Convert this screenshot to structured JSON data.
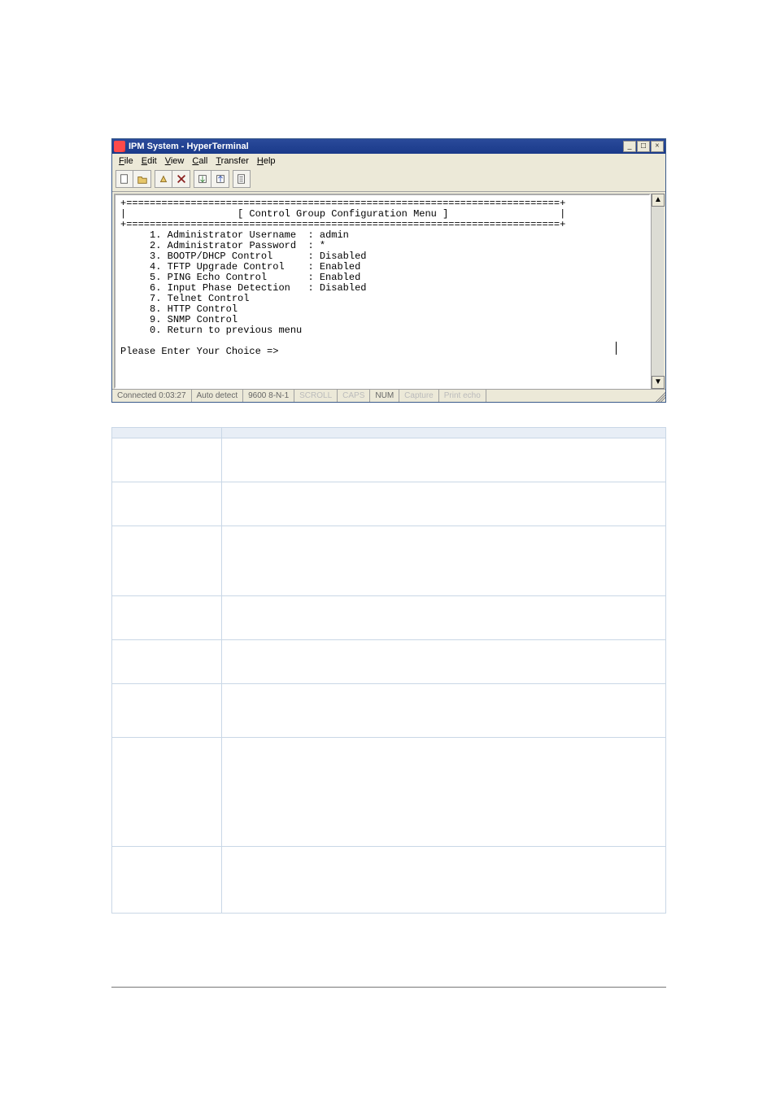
{
  "window": {
    "title": "IPM System - HyperTerminal",
    "controls": {
      "minimize": "_",
      "restore": "□",
      "close": "×"
    }
  },
  "menubar": {
    "items": [
      "File",
      "Edit",
      "View",
      "Call",
      "Transfer",
      "Help"
    ]
  },
  "toolbar": {
    "icons": [
      "new-icon",
      "open-icon",
      "connect-icon",
      "disconnect-icon",
      "send-icon",
      "receive-icon",
      "properties-icon"
    ]
  },
  "terminal": {
    "header": "[ Control Group Configuration Menu ]",
    "lines": [
      {
        "num": "1",
        "label": "Administrator Username",
        "value": "admin"
      },
      {
        "num": "2",
        "label": "Administrator Password",
        "value": "*"
      },
      {
        "num": "3",
        "label": "BOOTP/DHCP Control",
        "value": "Disabled"
      },
      {
        "num": "4",
        "label": "TFTP Upgrade Control",
        "value": "Enabled"
      },
      {
        "num": "5",
        "label": "PING Echo Control",
        "value": "Enabled"
      },
      {
        "num": "6",
        "label": "Input Phase Detection",
        "value": "Disabled"
      },
      {
        "num": "7",
        "label": "Telnet Control",
        "value": ""
      },
      {
        "num": "8",
        "label": "HTTP Control",
        "value": ""
      },
      {
        "num": "9",
        "label": "SNMP Control",
        "value": ""
      },
      {
        "num": "0",
        "label": "Return to previous menu",
        "value": ""
      }
    ],
    "prompt": "Please Enter Your Choice =>"
  },
  "statusbar": {
    "connected": "Connected 0:03:27",
    "detect": "Auto detect",
    "settings": "9600 8-N-1",
    "scroll": "SCROLL",
    "caps": "CAPS",
    "num": "NUM",
    "capture": "Capture",
    "echo": "Print echo"
  },
  "table": {
    "headers": [
      "",
      ""
    ],
    "rows": [
      [
        "",
        ""
      ],
      [
        "",
        ""
      ],
      [
        "",
        ""
      ],
      [
        "",
        ""
      ],
      [
        "",
        ""
      ],
      [
        "",
        ""
      ],
      [
        "",
        ""
      ],
      [
        "",
        ""
      ]
    ]
  }
}
